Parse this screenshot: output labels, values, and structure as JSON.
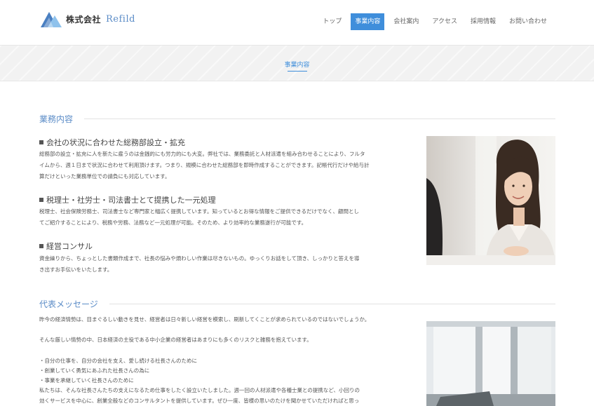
{
  "header": {
    "logo_text": "株式会社",
    "logo_sub": "Refild",
    "nav": [
      {
        "label": "トップ",
        "active": false
      },
      {
        "label": "事業内容",
        "active": true
      },
      {
        "label": "会社案内",
        "active": false
      },
      {
        "label": "アクセス",
        "active": false
      },
      {
        "label": "採用情報",
        "active": false
      },
      {
        "label": "お問い合わせ",
        "active": false
      }
    ]
  },
  "hero": {
    "title": "事業内容"
  },
  "business": {
    "heading": "業務内容",
    "items": [
      {
        "title": "会社の状況に合わせた総務部設立・拡充",
        "lines": [
          "総務部の設立・拡充に人を新たに雇うのは金銭的にも労力的にも大変。弊社では、業務委託と人材派遣を組み合わせることにより、フルタ",
          "イムから、週１日まで状況に合わせて利用頂けます。つまり、規模に合わせた総務部を即時作成することができます。記帳代行だけや給与計",
          "算だけといった業務単位での請負にも対応しています。"
        ]
      },
      {
        "title": "税理士・社労士・司法書士とて提携した一元処理",
        "lines": [
          "税理士、社会保険労務士、司法書士など専門家と幅広く提携しています。知っているとお得な情報をご提供できるだけでなく、顧問とし",
          "てご紹介することにより、税務や労務、法務など一元処理が可能。そのため、より効率的な業務遂行が可能です。"
        ]
      },
      {
        "title": "経営コンサル",
        "lines": [
          "資金繰りから、ちょっとした書類作成まで、社長の悩みや煩わしい作業は尽きないもの。ゆっくりお話をして頂き、しっかりと答えを導",
          "き出すお手伝いをいたします。"
        ]
      }
    ]
  },
  "message": {
    "heading": "代表メッセージ",
    "lines": [
      "昨今の経済情勢は、目まぐるしい動きを見せ、経営者は日々新しい経営を模索し、刷新してくことが求められているのではないでしょうか。",
      "そんな厳しい情勢の中、日本経済の主役である中小企業の経営者はあまりにも多くのリスクと雑務を抱えています。",
      "",
      "・自分の仕事を、自分の会社を支え、愛し続ける社長さんのために",
      "・創業していく勇気にあふれた社長さんの為に",
      "・事業を承継していく社長さんのために",
      "私たちは、そんな社長さんたちの支えになるため仕事をしたく設立いたしました。週一回の人材派遣や各種士業との提携など、小回りの",
      "効くサービスを中心に、創業全般などのコンサルタントを提供しています。ぜひ一度、皆様の思いのたけを聞かせていただければと思っ"
    ]
  },
  "colors": {
    "accent": "#3f8edb",
    "heading": "#5b8cc7"
  }
}
